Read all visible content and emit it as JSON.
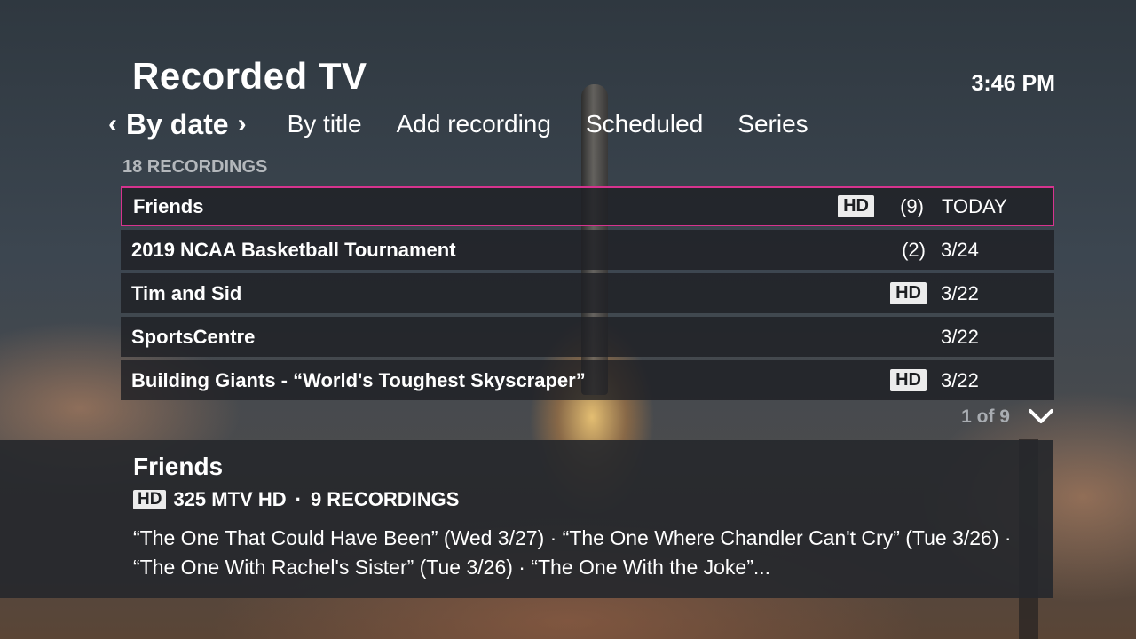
{
  "header": {
    "title": "Recorded TV",
    "clock": "3:46 PM"
  },
  "nav": {
    "prev_arrow": "‹",
    "next_arrow": "›",
    "active_tab": "By date",
    "tabs": [
      "By title",
      "Add recording",
      "Scheduled",
      "Series"
    ]
  },
  "list": {
    "count_label": "18 RECORDINGS",
    "rows": [
      {
        "name": "Friends",
        "hd": "HD",
        "recordings": "(9)",
        "date": "TODAY"
      },
      {
        "name": "2019 NCAA Basketball Tournament",
        "hd": "",
        "recordings": "(2)",
        "date": "3/24"
      },
      {
        "name": "Tim and Sid",
        "hd": "HD",
        "recordings": "",
        "date": "3/22"
      },
      {
        "name": "SportsCentre",
        "hd": "",
        "recordings": "",
        "date": "3/22"
      },
      {
        "name": "Building Giants - “World's Toughest Skyscraper”",
        "hd": "HD",
        "recordings": "",
        "date": "3/22"
      }
    ],
    "pager": "1 of 9"
  },
  "detail": {
    "title": "Friends",
    "hd": "HD",
    "channel": "325 MTV HD",
    "separator": "·",
    "recordings": "9 RECORDINGS",
    "description": "“The One That Could Have Been” (Wed 3/27) · “The One Where Chandler Can't Cry” (Tue 3/26) · “The One With Rachel's Sister” (Tue 3/26) · “The One With the Joke”..."
  },
  "colors": {
    "selection": "#d6338e",
    "row_bg": "#1e2024",
    "badge_bg": "#ececec"
  }
}
